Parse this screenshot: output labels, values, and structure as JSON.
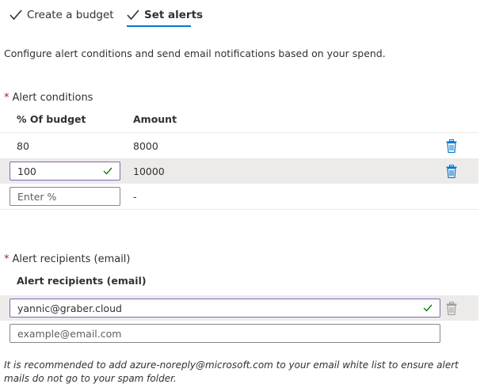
{
  "tabs": [
    {
      "label": "Create a budget",
      "active": false
    },
    {
      "label": "Set alerts",
      "active": true
    }
  ],
  "description": "Configure alert conditions and send email notifications based on your spend.",
  "alert_conditions": {
    "label": "Alert conditions",
    "required_mark": "*",
    "columns": {
      "percent": "% Of budget",
      "amount": "Amount"
    },
    "rows": [
      {
        "percent": "80",
        "amount": "8000"
      },
      {
        "percent": "100",
        "amount": "10000"
      }
    ],
    "new_row": {
      "placeholder": "Enter %",
      "amount": "-"
    }
  },
  "alert_recipients": {
    "label": "Alert recipients (email)",
    "required_mark": "*",
    "column": "Alert recipients (email)",
    "emails": [
      "yannic@graber.cloud"
    ],
    "new_placeholder": "example@email.com"
  },
  "note": "It is recommended to add azure-noreply@microsoft.com to your email white list to ensure alert mails do not go to your spam folder.",
  "colors": {
    "accent": "#0078d4",
    "valid_check": "#107c10",
    "valid_border": "#8764b8",
    "required": "#a4262c",
    "row_highlight": "#edebe9"
  }
}
